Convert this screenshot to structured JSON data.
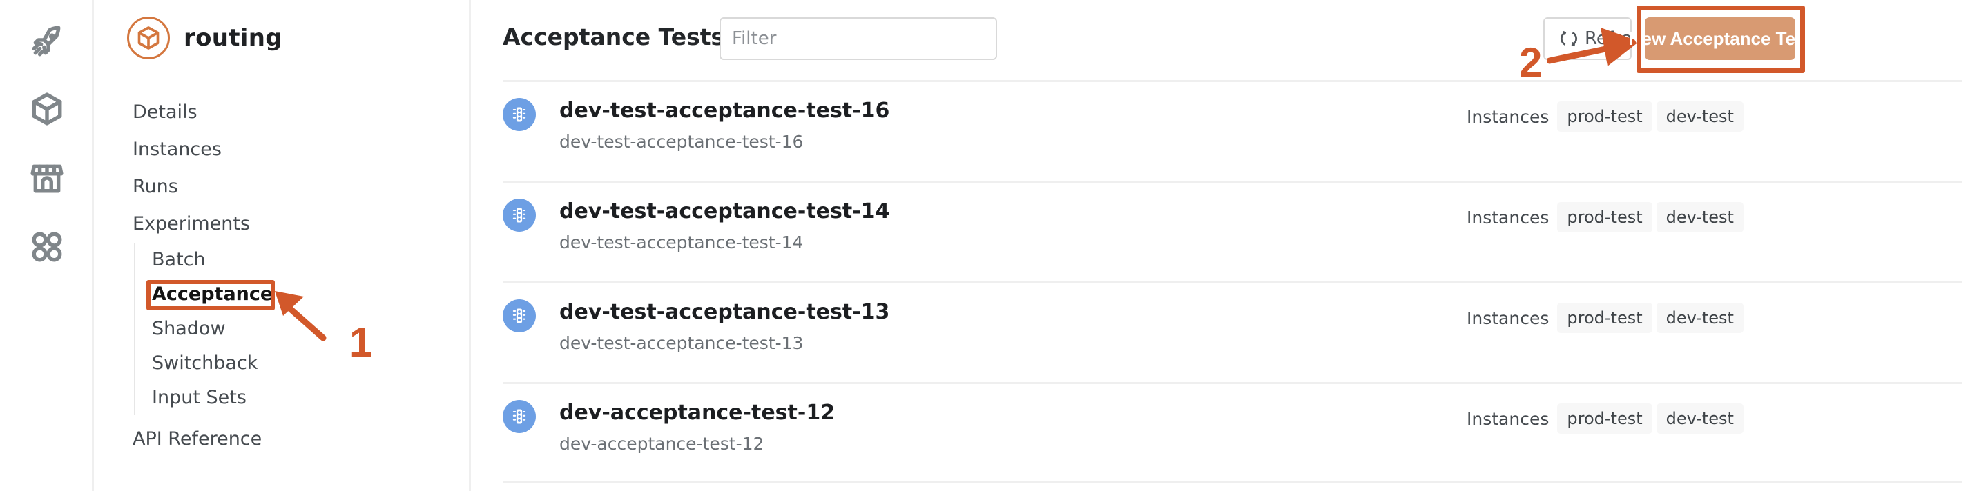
{
  "rail": {
    "items": [
      {
        "icon": "rocket-icon",
        "label": "Deployments"
      },
      {
        "icon": "cube-icon",
        "label": "Apps"
      },
      {
        "icon": "storefront-icon",
        "label": "Marketplace"
      },
      {
        "icon": "grid-circles-icon",
        "label": "More"
      }
    ]
  },
  "sidebar": {
    "app_name": "routing",
    "app_icon": "cube-icon",
    "items": [
      {
        "label": "Details"
      },
      {
        "label": "Instances"
      },
      {
        "label": "Runs"
      },
      {
        "label": "Experiments"
      }
    ],
    "experiments": [
      {
        "label": "Batch"
      },
      {
        "label": "Acceptance",
        "active": true
      },
      {
        "label": "Shadow"
      },
      {
        "label": "Switchback"
      },
      {
        "label": "Input Sets"
      }
    ],
    "footer_item": {
      "label": "API Reference"
    }
  },
  "header": {
    "title": "Acceptance Tests",
    "filter_placeholder": "Filter",
    "filter_value": "",
    "refresh_label": "Refresh",
    "new_label": "New Acceptance Test"
  },
  "annotations": {
    "step1": "1",
    "step2": "2",
    "color": "#d2582a"
  },
  "tests": [
    {
      "name": "dev-test-acceptance-test-16",
      "id": "dev-test-acceptance-test-16",
      "instances_label": "Instances",
      "instances": [
        "prod-test",
        "dev-test"
      ]
    },
    {
      "name": "dev-test-acceptance-test-14",
      "id": "dev-test-acceptance-test-14",
      "instances_label": "Instances",
      "instances": [
        "prod-test",
        "dev-test"
      ]
    },
    {
      "name": "dev-test-acceptance-test-13",
      "id": "dev-test-acceptance-test-13",
      "instances_label": "Instances",
      "instances": [
        "prod-test",
        "dev-test"
      ]
    },
    {
      "name": "dev-acceptance-test-12",
      "id": "dev-acceptance-test-12",
      "instances_label": "Instances",
      "instances": [
        "prod-test",
        "dev-test"
      ]
    }
  ],
  "colors": {
    "accent": "#d4773f",
    "primary_button": "#d89a72",
    "row_icon": "#6d9fe4"
  }
}
